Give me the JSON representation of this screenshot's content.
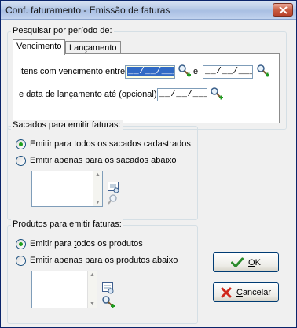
{
  "window": {
    "title": "Conf. faturamento - Emissão de faturas"
  },
  "period": {
    "legend": "Pesquisar por período de:",
    "tabs": [
      {
        "label": "Vencimento"
      },
      {
        "label": "Lançamento"
      }
    ],
    "due_label": "Itens com vencimento entre",
    "due_start_value": "__/__/____",
    "and_label": "e",
    "due_end_value": "__/__/____",
    "launch_label": "e data de lançamento até (opcional):",
    "launch_value": "__/__/____"
  },
  "debtors": {
    "legend": "Sacados para emitir faturas:",
    "option_all": "Emitir para todos os sacados cadastrados",
    "option_some_prefix": "Emitir apenas para os sacados ",
    "option_some_mnemonic": "a",
    "option_some_suffix": "baixo",
    "selected": "all"
  },
  "products": {
    "legend": "Produtos para emitir faturas:",
    "option_all_prefix": "Emitir para ",
    "option_all_mnemonic": "t",
    "option_all_suffix": "odos os produtos",
    "option_some_prefix": "Emitir apenas para os produtos ",
    "option_some_mnemonic": "a",
    "option_some_suffix": "baixo",
    "selected": "all"
  },
  "buttons": {
    "ok_mnemonic": "O",
    "ok_rest": "K",
    "cancel_mnemonic": "C",
    "cancel_rest": "ancelar"
  },
  "colors": {
    "ok_check": "#2a8a2a",
    "cancel_x": "#d0281b",
    "radio_dot": "#21a121"
  }
}
